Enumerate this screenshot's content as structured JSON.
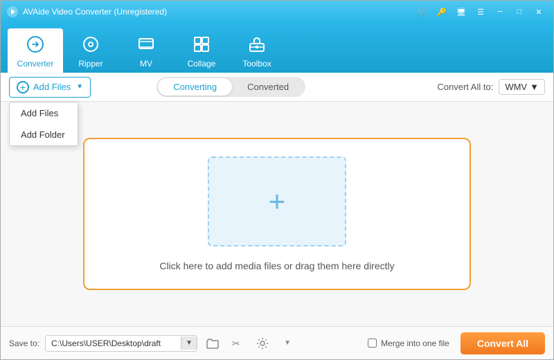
{
  "titleBar": {
    "text": "AVAide Video Converter (Unregistered)",
    "controls": [
      "cart",
      "key",
      "monitor",
      "menu",
      "minimize",
      "maximize",
      "close"
    ]
  },
  "nav": {
    "items": [
      {
        "id": "converter",
        "label": "Converter",
        "icon": "⟳",
        "active": true
      },
      {
        "id": "ripper",
        "label": "Ripper",
        "icon": "◎"
      },
      {
        "id": "mv",
        "label": "MV",
        "icon": "🖼"
      },
      {
        "id": "collage",
        "label": "Collage",
        "icon": "⊞"
      },
      {
        "id": "toolbox",
        "label": "Toolbox",
        "icon": "🧰"
      }
    ]
  },
  "toolbar": {
    "addFilesLabel": "Add Files",
    "dropdownItems": [
      "Add Files",
      "Add Folder"
    ],
    "tabs": [
      "Converting",
      "Converted"
    ],
    "activeTab": "Converting",
    "convertAllToLabel": "Convert All to:",
    "selectedFormat": "WMV"
  },
  "dropZone": {
    "text": "Click here to add media files or drag them here directly"
  },
  "footer": {
    "saveToLabel": "Save to:",
    "path": "C:\\Users\\USER\\Desktop\\draft",
    "mergeLabel": "Merge into one file",
    "convertAllLabel": "Convert All"
  }
}
